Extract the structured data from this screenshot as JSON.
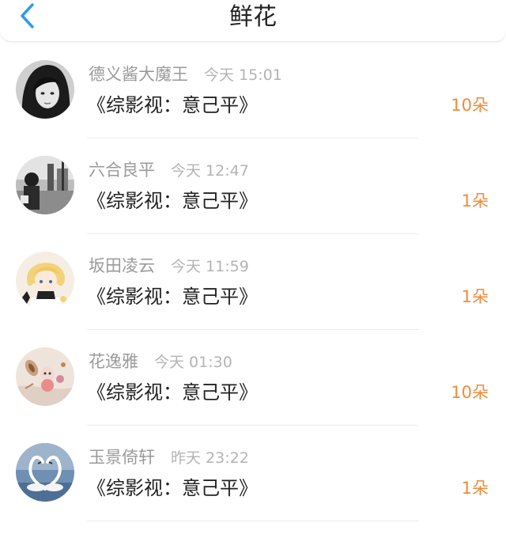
{
  "header": {
    "title": "鲜花",
    "back_icon": "chevron-left-icon",
    "accent_color": "#2f9bf0"
  },
  "flowers": [
    {
      "name": "德义酱大魔王",
      "time": "今天 15:01",
      "book": "《综影视：意己平》",
      "count": "10朵",
      "avatar": "girl-photo-avatar"
    },
    {
      "name": "六合良平",
      "time": "今天 12:47",
      "book": "《综影视：意己平》",
      "count": "1朵",
      "avatar": "street-photo-avatar"
    },
    {
      "name": "坂田凌云",
      "time": "今天 11:59",
      "book": "《综影视：意己平》",
      "count": "1朵",
      "avatar": "anime-character-avatar"
    },
    {
      "name": "花逸雅",
      "time": "今天 01:30",
      "book": "《综影视：意己平》",
      "count": "10朵",
      "avatar": "crafts-photo-avatar"
    },
    {
      "name": "玉景倚轩",
      "time": "昨天 23:22",
      "book": "《综影视：意己平》",
      "count": "1朵",
      "avatar": "swans-photo-avatar"
    }
  ],
  "colors": {
    "count": "#f08b3b",
    "name": "#9a9a9a",
    "time": "#b3b3b3"
  }
}
